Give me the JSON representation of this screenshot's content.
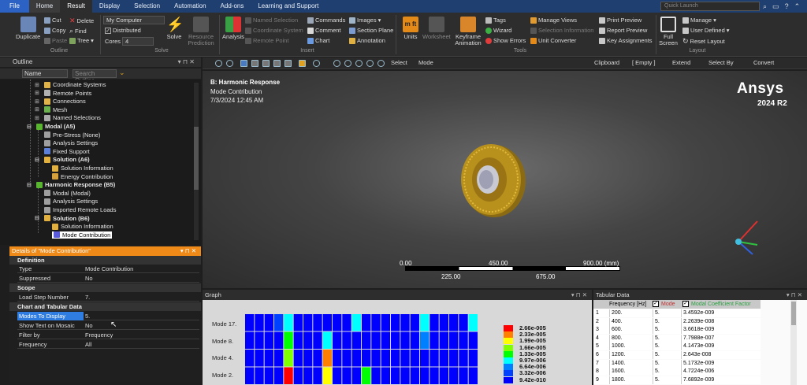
{
  "menu": {
    "tabs": [
      "File",
      "Home",
      "Result",
      "Display",
      "Selection",
      "Automation",
      "Add-ons",
      "Learning and Support"
    ],
    "quick_launch_placeholder": "Quick Launch"
  },
  "ribbon": {
    "outline_group": {
      "duplicate": "Duplicate",
      "cut": "Cut",
      "copy": "Copy",
      "paste": "Paste",
      "delete": "Delete",
      "find": "Find",
      "tree": "Tree",
      "label": "Outline"
    },
    "solve_group": {
      "computer": "My Computer",
      "distributed": "Distributed",
      "cores_label": "Cores",
      "cores_value": "4",
      "solve": "Solve",
      "resource": "Resource Prediction",
      "label": "Solve"
    },
    "analysis": "Analysis",
    "insert_group": {
      "named_selection": "Named Selection",
      "coordinate_system": "Coordinate System",
      "remote_point": "Remote Point",
      "commands": "Commands",
      "comment": "Comment",
      "chart": "Chart",
      "images": "Images",
      "section_plane": "Section Plane",
      "annotation": "Annotation",
      "label": "Insert"
    },
    "units": "Units",
    "worksheet": "Worksheet",
    "keyframe": "Keyframe Animation",
    "tools_group": {
      "tags": "Tags",
      "wizard": "Wizard",
      "show_errors": "Show Errors",
      "manage_views": "Manage Views",
      "selection_information": "Selection Information",
      "unit_converter": "Unit Converter",
      "print_preview": "Print Preview",
      "report_preview": "Report Preview",
      "key_assignments": "Key Assignments",
      "label": "Tools"
    },
    "full_screen": "Full Screen",
    "layout_group": {
      "manage": "Manage",
      "user_defined": "User Defined",
      "reset_layout": "Reset Layout",
      "label": "Layout"
    }
  },
  "toolbar": {
    "select": "Select",
    "mode": "Mode",
    "clipboard": "Clipboard",
    "empty": "[ Empty ]",
    "extend": "Extend",
    "select_by": "Select By",
    "convert": "Convert"
  },
  "outline": {
    "title": "Outline",
    "filter_name": "Name",
    "search_placeholder": "Search Outline",
    "items": [
      {
        "label": "Coordinate Systems",
        "color": "#e0b34a"
      },
      {
        "label": "Remote Points",
        "color": "#b0b0b0"
      },
      {
        "label": "Connections",
        "color": "#e0b34a"
      },
      {
        "label": "Mesh",
        "color": "#6ab04c"
      },
      {
        "label": "Named Selections",
        "color": "#aaa"
      },
      {
        "label": "Modal (A5)",
        "color": "#59b42f"
      },
      {
        "label": "Pre-Stress (None)",
        "color": "#9e9e9e"
      },
      {
        "label": "Analysis Settings",
        "color": "#9e9e9e"
      },
      {
        "label": "Fixed Support",
        "color": "#5b7fd6"
      },
      {
        "label": "Solution (A6)",
        "color": "#e2b03e"
      },
      {
        "label": "Solution Information",
        "color": "#e2b03e"
      },
      {
        "label": "Energy Contribution",
        "color": "#d6a13a"
      },
      {
        "label": "Harmonic Response (B5)",
        "color": "#59b42f"
      },
      {
        "label": "Modal (Modal)",
        "color": "#9e9e9e"
      },
      {
        "label": "Analysis Settings",
        "color": "#9e9e9e"
      },
      {
        "label": "Imported Remote Loads",
        "color": "#9e9e9e"
      },
      {
        "label": "Solution (B6)",
        "color": "#e2b03e"
      },
      {
        "label": "Solution Information",
        "color": "#e2b03e"
      },
      {
        "label": "Mode Contribution",
        "color": "#5a5adc"
      }
    ]
  },
  "details": {
    "title": "Details of \"Mode Contribution\"",
    "sections": {
      "definition": "Definition",
      "scope": "Scope",
      "chart": "Chart and Tabular Data"
    },
    "rows": {
      "type": {
        "k": "Type",
        "v": "Mode Contribution"
      },
      "suppressed": {
        "k": "Suppressed",
        "v": "No"
      },
      "load_step": {
        "k": "Load Step Number",
        "v": "7."
      },
      "modes": {
        "k": "Modes To Display",
        "v": "5."
      },
      "show_text": {
        "k": "Show Text on Mosaic",
        "v": "No"
      },
      "filter": {
        "k": "Filter by",
        "v": "Frequency"
      },
      "frequency": {
        "k": "Frequency",
        "v": "All"
      }
    }
  },
  "viewport": {
    "title": "B: Harmonic Response",
    "subtitle": "Mode Contribution",
    "date": "7/3/2024 12:45 AM",
    "brand": "Ansys",
    "version": "2024 R2",
    "scale_top": [
      "0.00",
      "450.00",
      "900.00 (mm)"
    ],
    "scale_bottom": [
      "225.00",
      "675.00"
    ]
  },
  "graph": {
    "title": "Graph",
    "mode_labels": [
      "Mode 17.",
      "Mode 8.",
      "Mode 4.",
      "Mode 2."
    ],
    "legend_values": [
      "2.66e-005",
      "2.33e-005",
      "1.99e-005",
      "1.66e-005",
      "1.33e-005",
      "9.97e-006",
      "6.64e-006",
      "3.32e-006",
      "9.42e-010"
    ],
    "legend_colors": [
      "#ff0000",
      "#ff8000",
      "#ffff00",
      "#80ff00",
      "#00ff00",
      "#00ffff",
      "#0080ff",
      "#0040ff",
      "#0000ff"
    ]
  },
  "chart_data": {
    "type": "heatmap",
    "title": "Graph",
    "rows": [
      "Mode 17.",
      "Mode 8.",
      "Mode 4.",
      "Mode 2."
    ],
    "legend_values": [
      2.66e-05,
      2.33e-05,
      1.99e-05,
      1.66e-05,
      1.33e-05,
      9.97e-06,
      6.64e-06,
      3.32e-06,
      9.42e-10
    ]
  },
  "tabular": {
    "title": "Tabular Data",
    "headers": [
      "Frequency [Hz]",
      "Mode",
      "Modal Coefficient Factor"
    ],
    "rows": [
      [
        "1",
        "200.",
        "5.",
        "3.4592e-009"
      ],
      [
        "2",
        "400.",
        "5.",
        "2.2639e-008"
      ],
      [
        "3",
        "600.",
        "5.",
        "3.6618e-009"
      ],
      [
        "4",
        "800.",
        "5.",
        "7.7988e-007"
      ],
      [
        "5",
        "1000.",
        "5.",
        "4.1473e-009"
      ],
      [
        "6",
        "1200.",
        "5.",
        "2.643e-008"
      ],
      [
        "7",
        "1400.",
        "5.",
        "5.1732e-009"
      ],
      [
        "8",
        "1600.",
        "5.",
        "4.7224e-006"
      ],
      [
        "9",
        "1800.",
        "5.",
        "7.6892e-009"
      ]
    ]
  }
}
